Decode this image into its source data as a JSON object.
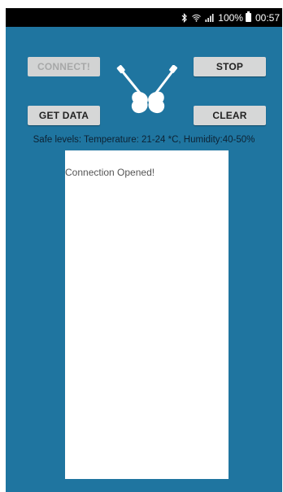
{
  "status_bar": {
    "battery": "100%",
    "time": "00:57",
    "icons": [
      "bluetooth-icon",
      "wifi-icon",
      "signal-icon",
      "battery-icon"
    ]
  },
  "buttons": {
    "connect": "CONNECT!",
    "stop": "STOP",
    "get_data": "GET DATA",
    "clear": "CLEAR"
  },
  "logo": {
    "icon": "crossed-guitars-icon"
  },
  "safe_levels": "Safe levels: Temperature: 21-24 *C, Humidity:40-50%",
  "log": {
    "text": "Connection Opened!"
  },
  "colors": {
    "background": "#1f75a0",
    "button": "#d6d7d7",
    "log_background": "#ffffff",
    "status_bar": "#000000"
  }
}
